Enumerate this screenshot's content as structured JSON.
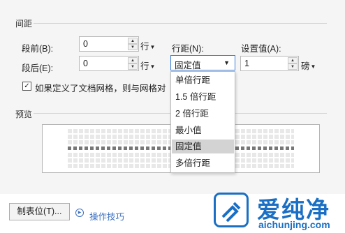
{
  "spacing": {
    "section_title": "间距",
    "before_label": "段前(B):",
    "before_value": "0",
    "after_label": "段后(E):",
    "after_value": "0",
    "unit_line": "行",
    "line_spacing_label": "行距(N):",
    "line_spacing_value": "固定值",
    "set_value_label": "设置值(A):",
    "set_value": "1",
    "set_value_unit": "磅",
    "grid_checkbox_label": "如果定义了文档网格，则与网格对",
    "grid_checkbox_checked": true
  },
  "line_spacing_options": [
    "单倍行距",
    "1.5 倍行距",
    "2 倍行距",
    "最小值",
    "固定值",
    "多倍行距"
  ],
  "line_spacing_selected": "固定值",
  "preview": {
    "section_title": "预览"
  },
  "footer": {
    "tabs_button": "制表位(T)...",
    "tips_link": "操作技巧"
  },
  "watermark": {
    "brand": "爱纯净",
    "url": "aichunjing.com",
    "color": "#1a6fc4"
  },
  "colors": {
    "focus_border": "#3c7ed8",
    "selected_item_bg": "#d3d3d3",
    "link": "#3a6fbf"
  }
}
